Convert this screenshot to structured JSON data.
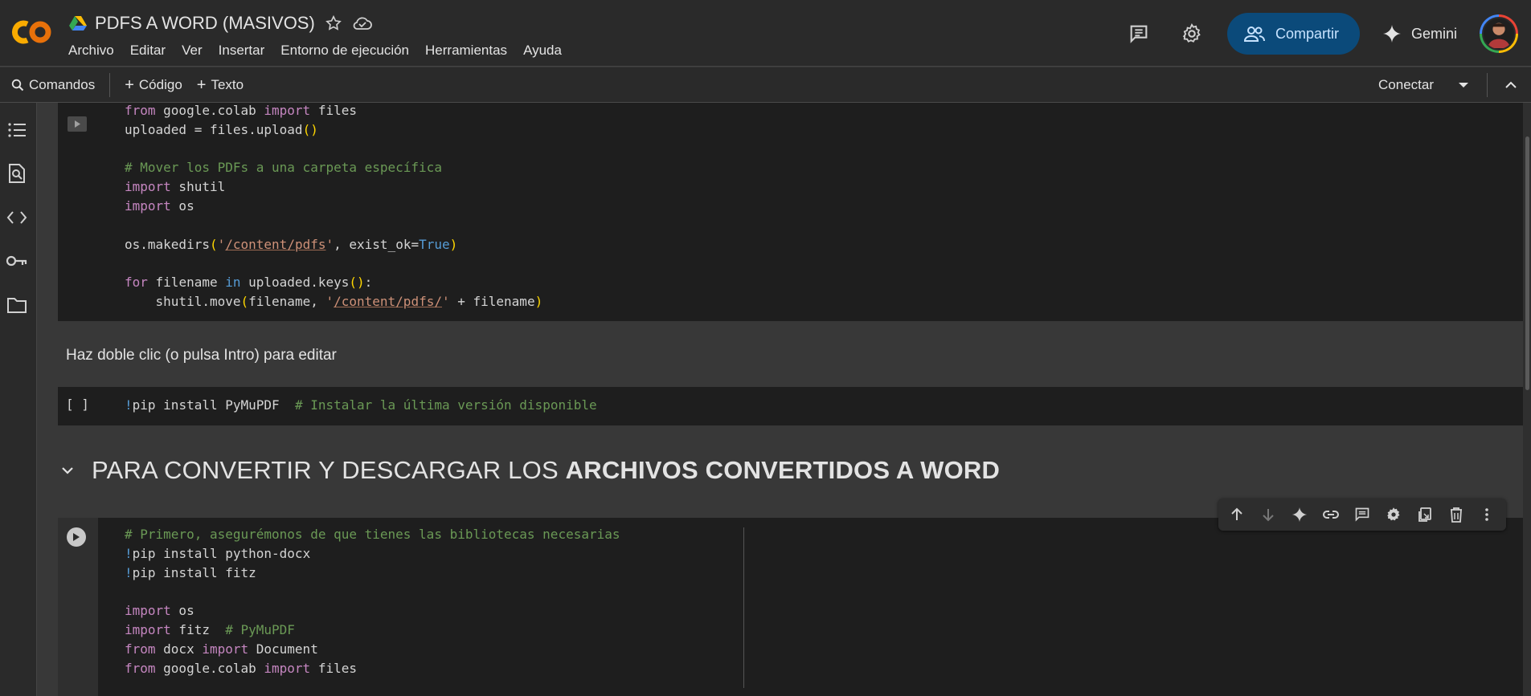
{
  "document": {
    "title": "PDFS A WORD (MASIVOS)"
  },
  "menu": [
    "Archivo",
    "Editar",
    "Ver",
    "Insertar",
    "Entorno de ejecución",
    "Herramientas",
    "Ayuda"
  ],
  "header": {
    "share_label": "Compartir",
    "gemini_label": "Gemini"
  },
  "toolbar": {
    "commands_label": "Comandos",
    "add_code_label": "Código",
    "add_text_label": "Texto",
    "connect_label": "Conectar"
  },
  "cells": {
    "upload_code": {
      "lines": [
        "from google.colab import files",
        "uploaded = files.upload()",
        "",
        "# Mover los PDFs a una carpeta específica",
        "import shutil",
        "import os",
        "",
        "os.makedirs('/content/pdfs', exist_ok=True)",
        "",
        "for filename in uploaded.keys():",
        "    shutil.move(filename, '/content/pdfs/' + filename)"
      ]
    },
    "text_placeholder": "Haz doble clic (o pulsa Intro) para editar",
    "pip_cell": {
      "exec_label": "[ ]",
      "line": "!pip install PyMuPDF  # Instalar la última versión disponible"
    },
    "section_heading": {
      "plain": "PARA CONVERTIR Y DESCARGAR LOS ",
      "bold": "ARCHIVOS CONVERTIDOS A WORD"
    },
    "convert_code": {
      "lines": [
        "# Primero, asegurémonos de que tienes las bibliotecas necesarias",
        "!pip install python-docx",
        "!pip install fitz",
        "",
        "import os",
        "import fitz  # PyMuPDF",
        "from docx import Document",
        "from google.colab import files"
      ]
    }
  },
  "icons": {
    "sidebar": [
      "toc-icon",
      "find-icon",
      "code-snippets-icon",
      "secrets-key-icon",
      "folder-icon"
    ],
    "cell_toolbar": [
      "move-up-icon",
      "move-down-icon",
      "gemini-sparkle-icon",
      "link-icon",
      "comment-icon",
      "settings-icon",
      "mirror-cell-icon",
      "delete-icon",
      "more-icon"
    ]
  },
  "colors": {
    "share_bg": "#0b4a7a",
    "logo_orange": "#f9ab00",
    "code_bg": "#1e1e1e"
  }
}
